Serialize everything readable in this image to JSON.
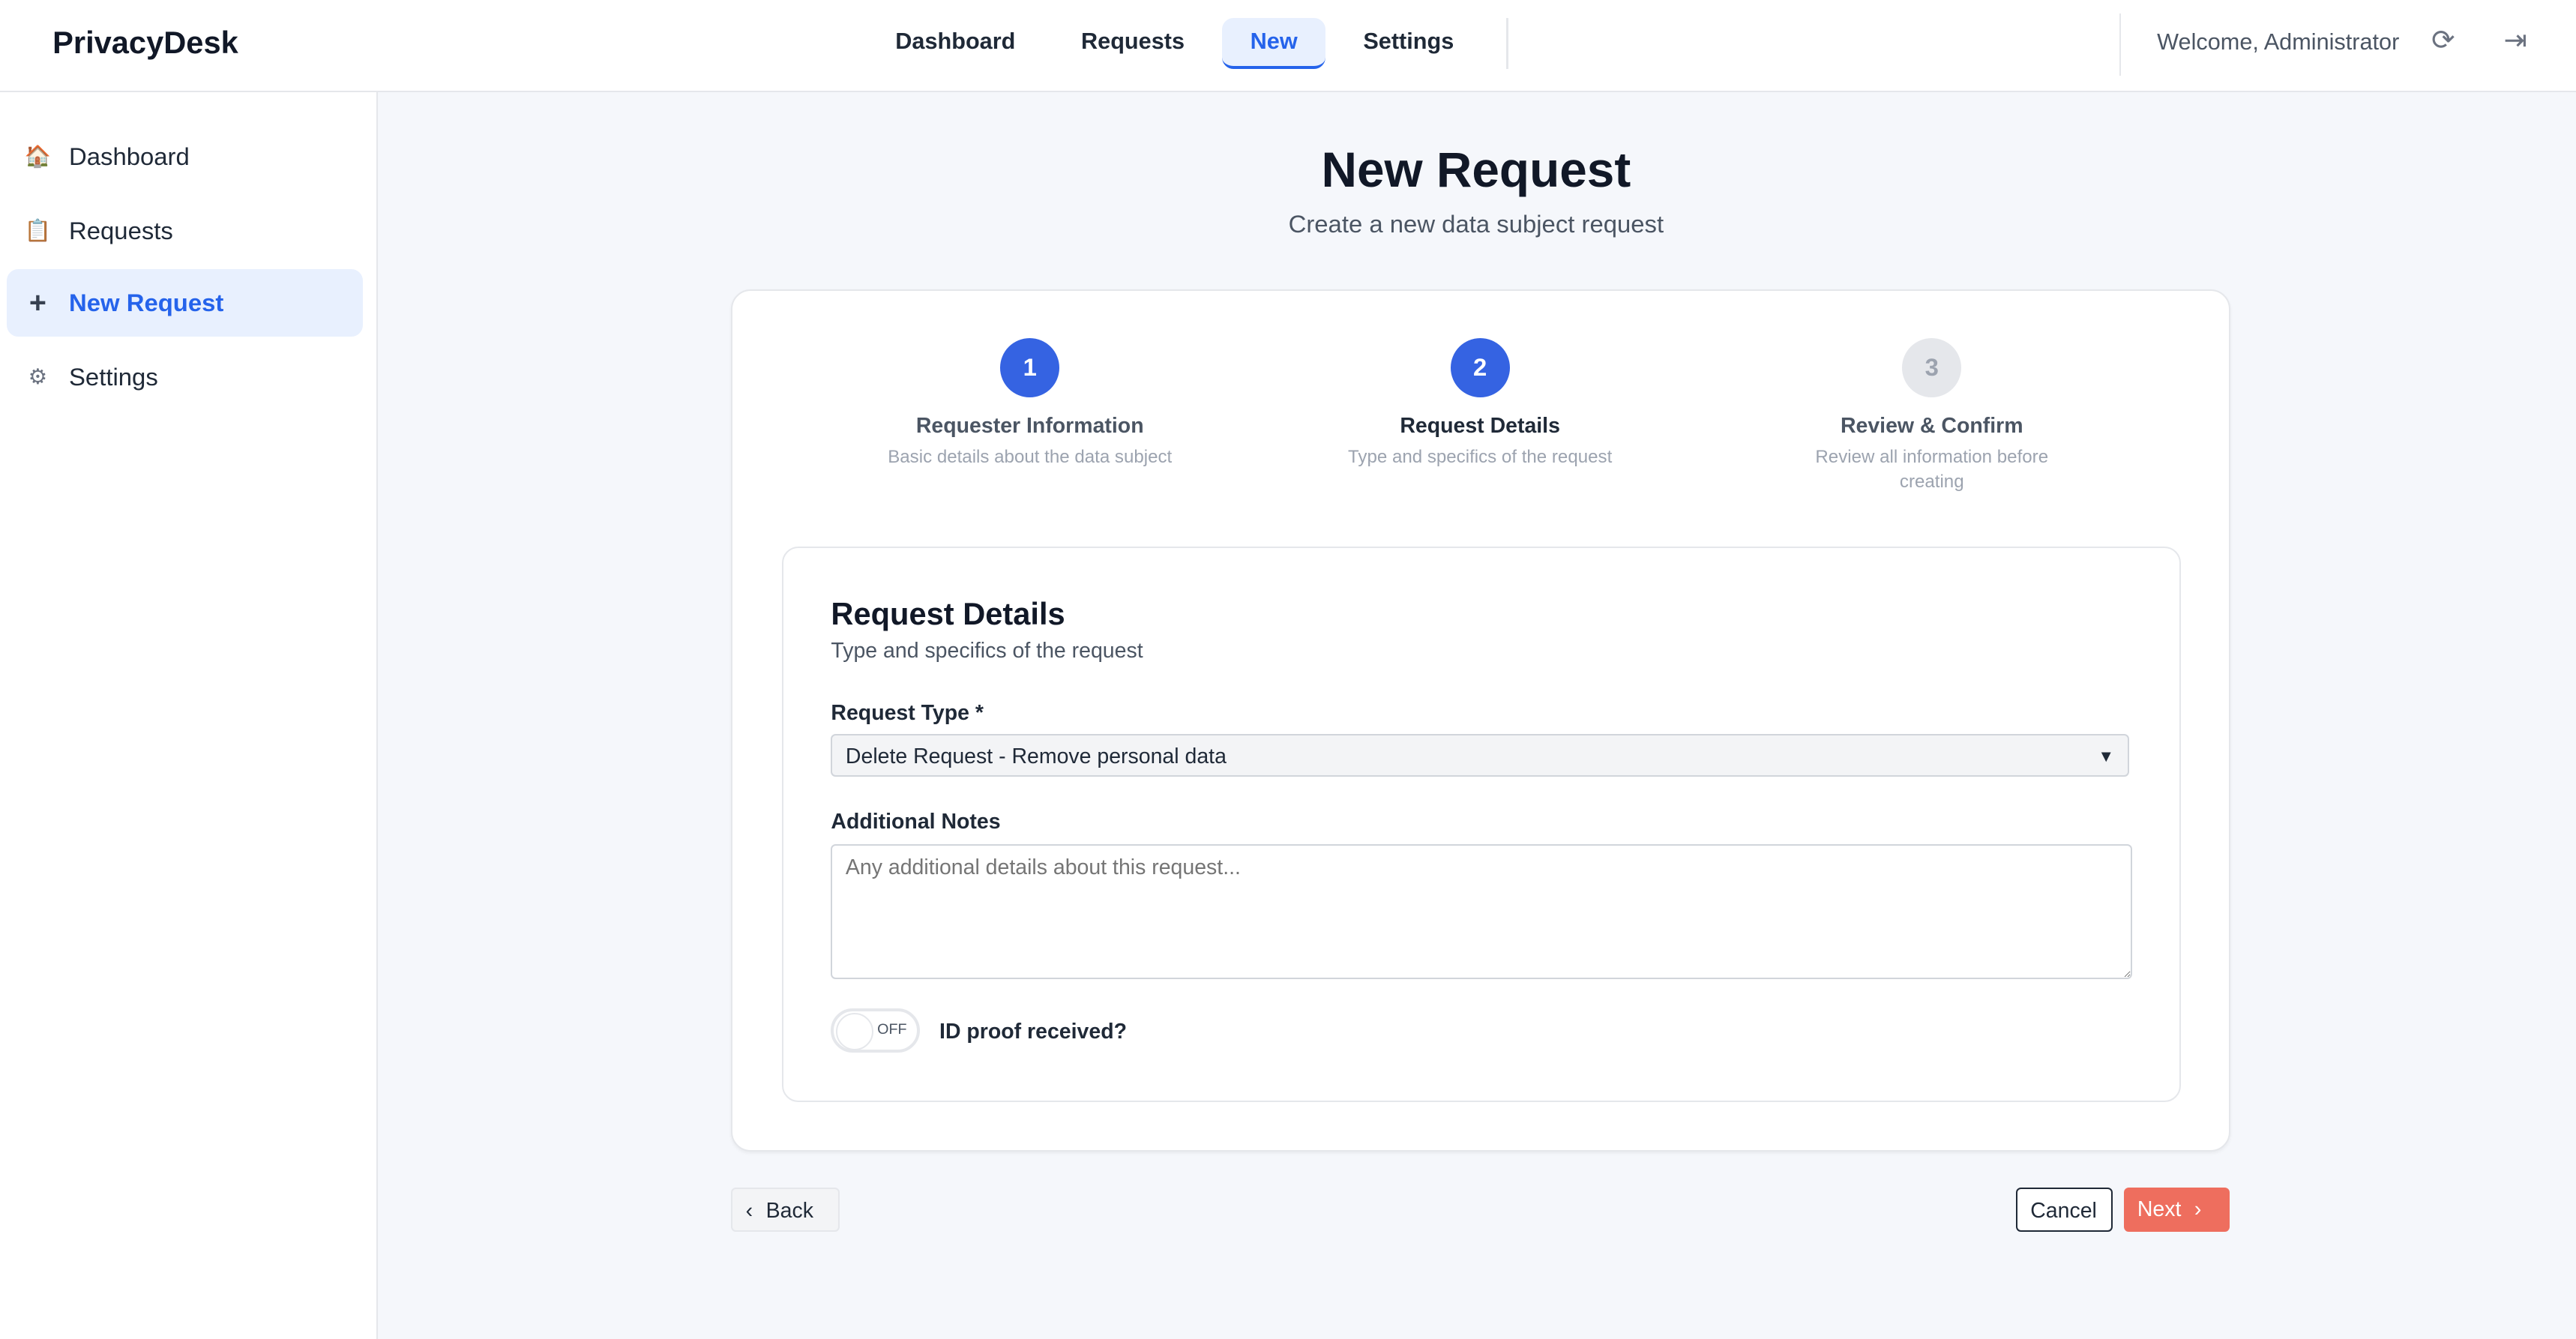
{
  "header": {
    "brand": "PrivacyDesk",
    "nav": [
      {
        "label": "Dashboard"
      },
      {
        "label": "Requests"
      },
      {
        "label": "New",
        "active": true
      },
      {
        "label": "Settings"
      }
    ],
    "welcome": "Welcome, Administrator",
    "icons": [
      "refresh-icon",
      "logout-icon"
    ]
  },
  "sidebar": {
    "items": [
      {
        "icon": "🏠",
        "label": "Dashboard"
      },
      {
        "icon": "📋",
        "label": "Requests"
      },
      {
        "icon": "+",
        "label": "New Request",
        "active": true
      },
      {
        "icon": "⚙",
        "label": "Settings"
      }
    ]
  },
  "page": {
    "title": "New Request",
    "subtitle": "Create a new data subject request"
  },
  "steps": [
    {
      "number": "1",
      "title": "Requester Information",
      "desc": "Basic details about the data subject",
      "state": "done"
    },
    {
      "number": "2",
      "title": "Request Details",
      "desc": "Type and specifics of the request",
      "state": "current"
    },
    {
      "number": "3",
      "title": "Review & Confirm",
      "desc": "Review all information before creating",
      "state": "pending"
    }
  ],
  "form": {
    "title": "Request Details",
    "subtitle": "Type and specifics of the request",
    "request_type_label": "Request Type *",
    "request_type_value": "Delete Request - Remove personal data",
    "notes_label": "Additional Notes",
    "notes_placeholder": "Any additional details about this request...",
    "id_toggle_state": "OFF",
    "id_toggle_label": "ID proof received?"
  },
  "actions": {
    "back": "Back",
    "cancel": "Cancel",
    "next": "Next"
  },
  "colors": {
    "primary": "#3563e2",
    "next_button": "#ee6e5e"
  }
}
